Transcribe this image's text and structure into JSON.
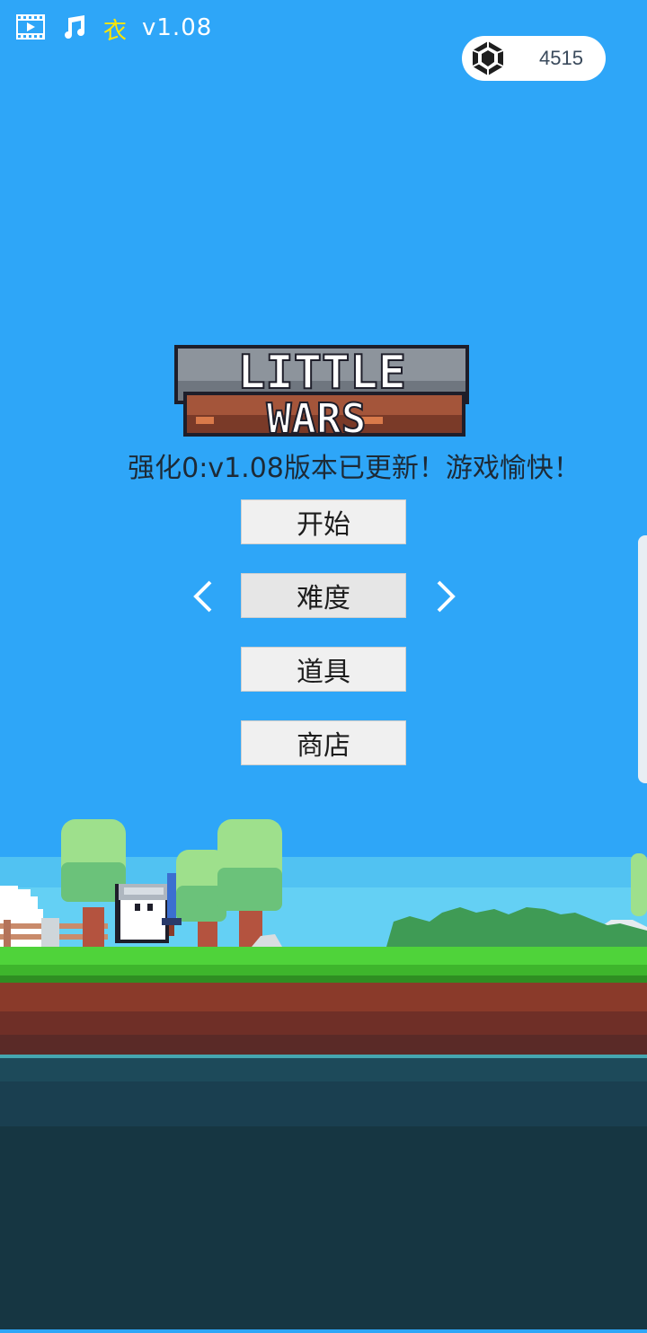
{
  "top_bar": {
    "video_icon": "film-icon",
    "music_icon": "music-note-icon",
    "language_char": "衣",
    "version": "v1.08"
  },
  "currency": {
    "icon": "gem-icon",
    "amount": "4515"
  },
  "logo": {
    "line1": "LITTLE",
    "line2": "WARS"
  },
  "notice": "强化0:v1.08版本已更新！游戏愉快！",
  "menu": {
    "start": "开始",
    "difficulty": "难度",
    "items": "道具",
    "shop": "商店"
  },
  "colors": {
    "sky": "#2ea6f8",
    "grass": "#4fd33a",
    "dirt": "#8a3a2a",
    "water": "#1d4a5a"
  }
}
